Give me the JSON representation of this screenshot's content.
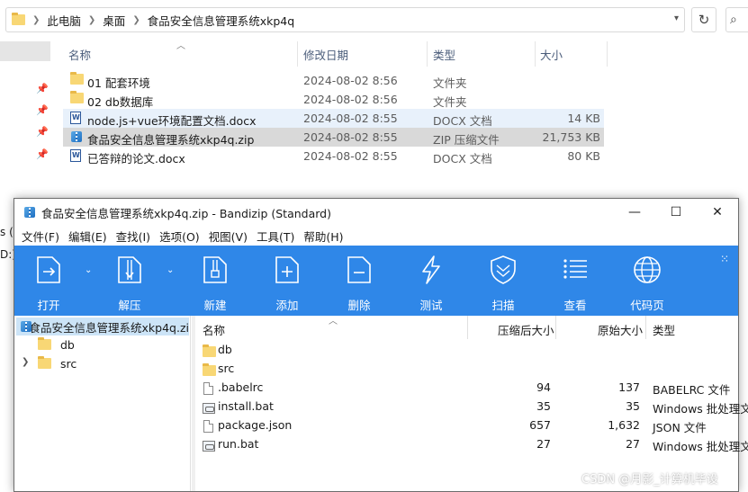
{
  "explorer": {
    "breadcrumb": [
      "此电脑",
      "桌面",
      "食品安全信息管理系统xkp4q"
    ],
    "columns": {
      "name": "名称",
      "date": "修改日期",
      "type": "类型",
      "size": "大小"
    },
    "nav_fragments": [
      "s (C",
      "D:)"
    ],
    "rows": [
      {
        "icon": "folder-icon",
        "name": "01  配套环境",
        "date": "2024-08-02 8:56",
        "type": "文件夹",
        "size": ""
      },
      {
        "icon": "folder-icon",
        "name": "02 db数据库",
        "date": "2024-08-02 8:56",
        "type": "文件夹",
        "size": ""
      },
      {
        "icon": "docx-icon",
        "name": "node.js+vue环境配置文档.docx",
        "date": "2024-08-02 8:55",
        "type": "DOCX 文档",
        "size": "14 KB"
      },
      {
        "icon": "zip-icon",
        "name": "食品安全信息管理系统xkp4q.zip",
        "date": "2024-08-02 8:55",
        "type": "ZIP 压缩文件",
        "size": "21,753 KB"
      },
      {
        "icon": "docx-icon",
        "name": "已答辩的论文.docx",
        "date": "2024-08-02 8:55",
        "type": "DOCX 文档",
        "size": "80 KB"
      }
    ]
  },
  "bandizip": {
    "title": "食品安全信息管理系统xkp4q.zip - Bandizip (Standard)",
    "menu": [
      "文件(F)",
      "编辑(E)",
      "查找(I)",
      "选项(O)",
      "视图(V)",
      "工具(T)",
      "帮助(H)"
    ],
    "toolbar": [
      {
        "id": "open",
        "label": "打开",
        "icon": "open-icon"
      },
      {
        "id": "extract",
        "label": "解压",
        "icon": "extract-icon"
      },
      {
        "id": "new",
        "label": "新建",
        "icon": "new-archive-icon"
      },
      {
        "id": "add",
        "label": "添加",
        "icon": "add-file-icon"
      },
      {
        "id": "delete",
        "label": "删除",
        "icon": "delete-file-icon"
      },
      {
        "id": "test",
        "label": "测试",
        "icon": "test-icon"
      },
      {
        "id": "scan",
        "label": "扫描",
        "icon": "shield-icon"
      },
      {
        "id": "view",
        "label": "查看",
        "icon": "list-view-icon"
      },
      {
        "id": "codepage",
        "label": "代码页",
        "icon": "globe-icon"
      }
    ],
    "tree": {
      "root": "食品安全信息管理系统xkp4q.zi",
      "children": [
        "db",
        "src"
      ]
    },
    "list_columns": {
      "name": "名称",
      "packed": "压缩后大小",
      "original": "原始大小",
      "type": "类型"
    },
    "list_rows": [
      {
        "icon": "folder-icon",
        "name": "db",
        "packed": "",
        "original": "",
        "type": ""
      },
      {
        "icon": "folder-icon",
        "name": "src",
        "packed": "",
        "original": "",
        "type": ""
      },
      {
        "icon": "file-icon",
        "name": ".babelrc",
        "packed": "94",
        "original": "137",
        "type": "BABELRC 文件"
      },
      {
        "icon": "bat-icon",
        "name": "install.bat",
        "packed": "35",
        "original": "35",
        "type": "Windows 批处理文件"
      },
      {
        "icon": "file-icon",
        "name": "package.json",
        "packed": "657",
        "original": "1,632",
        "type": "JSON 文件"
      },
      {
        "icon": "bat-icon",
        "name": "run.bat",
        "packed": "27",
        "original": "27",
        "type": "Windows 批处理文件"
      }
    ]
  },
  "watermark": "CSDN @月影_计算机毕设",
  "colors": {
    "toolbar_blue": "#2f87e8",
    "selection_gray": "#d9d9d9",
    "tree_selection": "#cce4f7"
  }
}
